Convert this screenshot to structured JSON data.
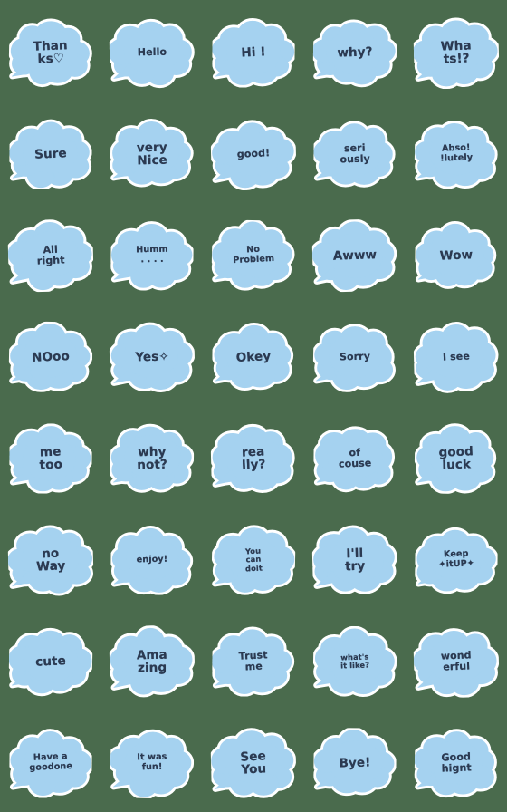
{
  "page": {
    "title": "Handwritten Blue Cloud Speech Bubble Emoji Set",
    "background_color": "#4a6b4d",
    "bubble_fill_color": "#a5d2f0",
    "bubble_outline_color": "#ffffff",
    "text_color": "#2b3a52",
    "columns": 5,
    "rows": 8,
    "total_stickers": 40
  },
  "stickers": [
    {
      "id": 1,
      "row": 1,
      "col": 1,
      "text": "Than\nks♡",
      "label": "Thanks"
    },
    {
      "id": 2,
      "row": 1,
      "col": 2,
      "text": "Hello",
      "label": "Hello"
    },
    {
      "id": 3,
      "row": 1,
      "col": 3,
      "text": "Hi !",
      "label": "Hi !"
    },
    {
      "id": 4,
      "row": 1,
      "col": 4,
      "text": "why?",
      "label": "why?"
    },
    {
      "id": 5,
      "row": 1,
      "col": 5,
      "text": "Wha\nts!?",
      "label": "Whats!?"
    },
    {
      "id": 6,
      "row": 2,
      "col": 1,
      "text": "Sure",
      "label": "Sure"
    },
    {
      "id": 7,
      "row": 2,
      "col": 2,
      "text": "very\nNice",
      "label": "very Nice"
    },
    {
      "id": 8,
      "row": 2,
      "col": 3,
      "text": "good!",
      "label": "good!"
    },
    {
      "id": 9,
      "row": 2,
      "col": 4,
      "text": "seri\nously",
      "label": "seriously"
    },
    {
      "id": 10,
      "row": 2,
      "col": 5,
      "text": "Abso!\n!lutely",
      "label": "Absolutely"
    },
    {
      "id": 11,
      "row": 3,
      "col": 1,
      "text": "All\nright",
      "label": "All right"
    },
    {
      "id": 12,
      "row": 3,
      "col": 2,
      "text": "Humm\n. . . .",
      "label": "Humm...."
    },
    {
      "id": 13,
      "row": 3,
      "col": 3,
      "text": "No\nProblem",
      "label": "No Problem"
    },
    {
      "id": 14,
      "row": 3,
      "col": 4,
      "text": "Awww",
      "label": "Awww"
    },
    {
      "id": 15,
      "row": 3,
      "col": 5,
      "text": "Wow",
      "label": "Wow"
    },
    {
      "id": 16,
      "row": 4,
      "col": 1,
      "text": "NOoo",
      "label": "NOoo"
    },
    {
      "id": 17,
      "row": 4,
      "col": 2,
      "text": "Yes✧",
      "label": "Yes"
    },
    {
      "id": 18,
      "row": 4,
      "col": 3,
      "text": "Okey",
      "label": "Okey"
    },
    {
      "id": 19,
      "row": 4,
      "col": 4,
      "text": "Sorry",
      "label": "Sorry"
    },
    {
      "id": 20,
      "row": 4,
      "col": 5,
      "text": "I see",
      "label": "I see"
    },
    {
      "id": 21,
      "row": 5,
      "col": 1,
      "text": "me\ntoo",
      "label": "me too"
    },
    {
      "id": 22,
      "row": 5,
      "col": 2,
      "text": "why\nnot?",
      "label": "why not?"
    },
    {
      "id": 23,
      "row": 5,
      "col": 3,
      "text": "rea\nlly?",
      "label": "really?"
    },
    {
      "id": 24,
      "row": 5,
      "col": 4,
      "text": "of\ncouse",
      "label": "of couse"
    },
    {
      "id": 25,
      "row": 5,
      "col": 5,
      "text": "good\nluck",
      "label": "good luck"
    },
    {
      "id": 26,
      "row": 6,
      "col": 1,
      "text": "no\nWay",
      "label": "no Way"
    },
    {
      "id": 27,
      "row": 6,
      "col": 2,
      "text": "enjoy!",
      "label": "enjoy!"
    },
    {
      "id": 28,
      "row": 6,
      "col": 3,
      "text": "You\ncan\ndoit",
      "label": "You can doit"
    },
    {
      "id": 29,
      "row": 6,
      "col": 4,
      "text": "I'll\ntry",
      "label": "I'll try"
    },
    {
      "id": 30,
      "row": 6,
      "col": 5,
      "text": "Keep\n✦itUP✦",
      "label": "Keep itUP"
    },
    {
      "id": 31,
      "row": 7,
      "col": 1,
      "text": "cute",
      "label": "cute"
    },
    {
      "id": 32,
      "row": 7,
      "col": 2,
      "text": "Ama\nzing",
      "label": "Amazing"
    },
    {
      "id": 33,
      "row": 7,
      "col": 3,
      "text": "Trust\nme",
      "label": "Trust me"
    },
    {
      "id": 34,
      "row": 7,
      "col": 4,
      "text": "what's\nit like?",
      "label": "what's it like?"
    },
    {
      "id": 35,
      "row": 7,
      "col": 5,
      "text": "wond\nerful",
      "label": "wonderful"
    },
    {
      "id": 36,
      "row": 8,
      "col": 1,
      "text": "Have a\ngoodone",
      "label": "Have a goodone"
    },
    {
      "id": 37,
      "row": 8,
      "col": 2,
      "text": "It was\nfun!",
      "label": "It was fun!"
    },
    {
      "id": 38,
      "row": 8,
      "col": 3,
      "text": "See\nYou",
      "label": "See You"
    },
    {
      "id": 39,
      "row": 8,
      "col": 4,
      "text": "Bye!",
      "label": "Bye!"
    },
    {
      "id": 40,
      "row": 8,
      "col": 5,
      "text": "Good\nhignt",
      "label": "Good hignt"
    }
  ]
}
